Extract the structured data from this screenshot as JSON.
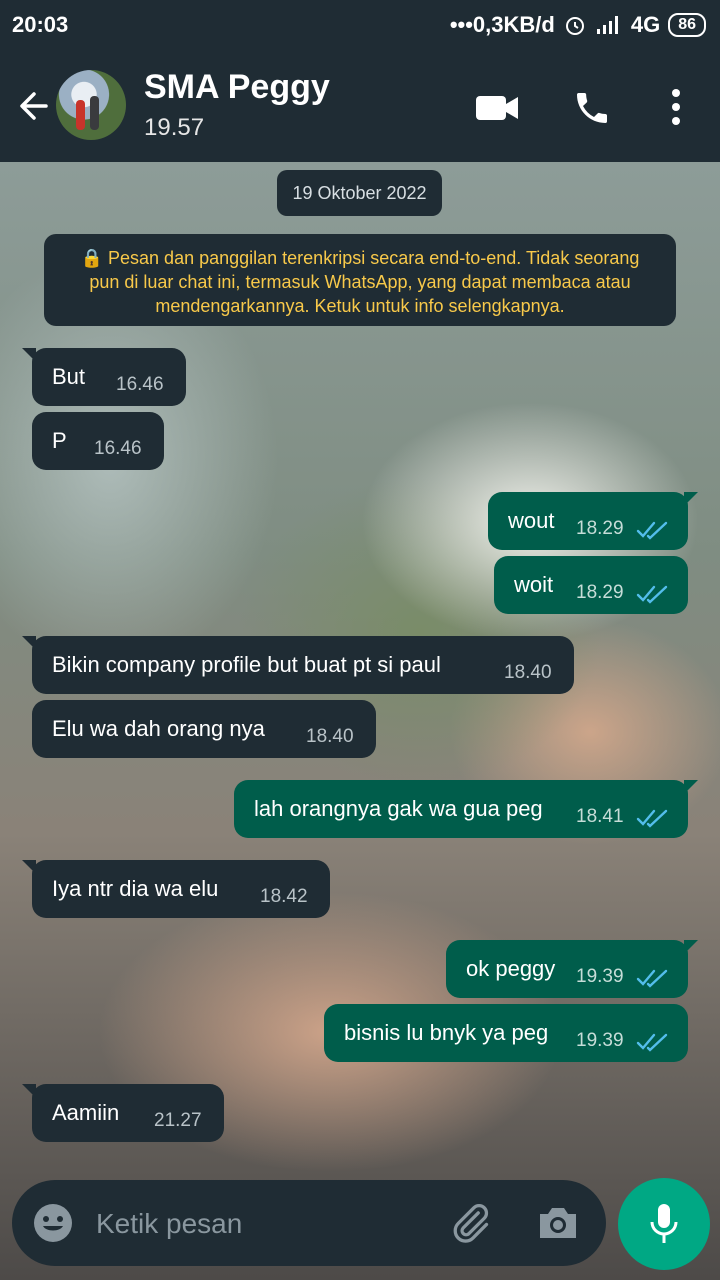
{
  "status_bar": {
    "time": "20:03",
    "network": "•••0,3KB/d",
    "signal": "4G",
    "battery": "86"
  },
  "header": {
    "contact_name": "SMA Peggy",
    "last_seen": "19.57",
    "icons": [
      "back-arrow-icon",
      "video-call-icon",
      "phone-icon",
      "more-vert-icon"
    ]
  },
  "chat": {
    "date": "19 Oktober 2022",
    "encryption_notice": "🔒 Pesan dan panggilan terenkripsi secara end-to-end. Tidak seorang pun di luar chat ini, termasuk WhatsApp, yang dapat membaca atau mendengarkannya. Ketuk untuk info selengkapnya.",
    "messages": [
      {
        "dir": "in",
        "text": "But",
        "time": "16.46"
      },
      {
        "dir": "in",
        "text": "P",
        "time": "16.46"
      },
      {
        "dir": "out",
        "text": "wout",
        "time": "18.29",
        "status": "read"
      },
      {
        "dir": "out",
        "text": "woit",
        "time": "18.29",
        "status": "read"
      },
      {
        "dir": "in",
        "text": "Bikin company profile but buat pt si paul",
        "time": "18.40"
      },
      {
        "dir": "in",
        "text": "Elu wa dah orang nya",
        "time": "18.40"
      },
      {
        "dir": "out",
        "text": "lah orangnya gak wa gua peg",
        "time": "18.41",
        "status": "read"
      },
      {
        "dir": "in",
        "text": "Iya ntr dia wa elu",
        "time": "18.42"
      },
      {
        "dir": "out",
        "text": "ok peggy",
        "time": "19.39",
        "status": "read"
      },
      {
        "dir": "out",
        "text": "bisnis lu bnyk ya peg",
        "time": "19.39",
        "status": "read"
      },
      {
        "dir": "in",
        "text": "Aamiin",
        "time": "21.27"
      }
    ]
  },
  "composer": {
    "placeholder": "Ketik pesan",
    "icons": [
      "emoji-icon",
      "attach-icon",
      "camera-icon",
      "mic-icon"
    ]
  },
  "colors": {
    "bar": "#1f2c34",
    "incoming": "#1f2c34",
    "outgoing": "#005d4b",
    "accent": "#00a884",
    "read_tick": "#53bdeb",
    "notice_text": "#f8c94a"
  }
}
